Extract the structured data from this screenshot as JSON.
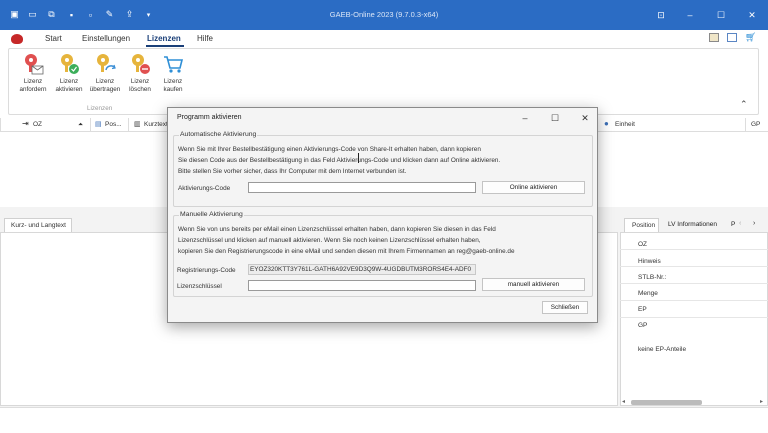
{
  "window": {
    "title": "GAEB-Online 2023 (9.7.0.3-x64)",
    "controls": {
      "settings": "⊡",
      "minimize": "–",
      "maximize": "☐",
      "close": "✕"
    },
    "accent": "#2b6cc4"
  },
  "quick_access": [
    "app-icon",
    "open-folder-icon",
    "copy-icon",
    "save-icon",
    "save-as-icon",
    "edit-icon",
    "export-icon",
    "customize-icon"
  ],
  "menu": {
    "items": [
      "Start",
      "Einstellungen",
      "Lizenzen",
      "Hilfe"
    ],
    "active": "Lizenzen"
  },
  "ribbon": {
    "buttons": [
      {
        "line1": "Lizenz",
        "line2": "anfordern",
        "icon": "key-mail-icon"
      },
      {
        "line1": "Lizenz",
        "line2": "aktivieren",
        "icon": "key-check-icon"
      },
      {
        "line1": "Lizenz",
        "line2": "übertragen",
        "icon": "key-transfer-icon"
      },
      {
        "line1": "Lizenz",
        "line2": "löschen",
        "icon": "key-delete-icon"
      },
      {
        "line1": "Lizenz",
        "line2": "kaufen",
        "icon": "cart-icon"
      }
    ],
    "group_label": "Lizenzen",
    "collapse": "⌃"
  },
  "grid": {
    "columns": [
      "OZ",
      "Pos...",
      "Kurztext",
      "Einheit",
      "GP"
    ]
  },
  "bottom_left": {
    "tab": "Kurz- und Langtext"
  },
  "right_panel": {
    "tabs": [
      "Position",
      "LV Informationen",
      "P"
    ],
    "properties": [
      "OZ",
      "Hinweis",
      "STLB-Nr.:",
      "Menge",
      "EP",
      "GP"
    ],
    "note": "keine EP-Anteile"
  },
  "dialog": {
    "title": "Programm aktivieren",
    "auto": {
      "title": "Automatische Aktivierung",
      "lines": [
        "Wenn Sie mit Ihrer Bestellbestätigung einen Aktivierungs-Code von Share-It erhalten haben, dann kopieren",
        "Sie diesen Code aus der Bestellbestätigung in das Feld Aktivierungs-Code und klicken dann auf Online aktivieren.",
        "Bitte stellen Sie vorher sicher, dass Ihr Computer mit dem Internet verbunden ist."
      ],
      "code_label": "Aktivierungs-Code",
      "code_value": "",
      "button": "Online aktivieren"
    },
    "manual": {
      "title": "Manuelle Aktivierung",
      "lines": [
        "Wenn Sie von uns bereits per eMail einen Lizenzschlüssel erhalten haben, dann kopieren Sie diesen in das Feld",
        "Lizenzschlüssel und klicken auf manuell aktivieren. Wenn Sie noch keinen Lizenzschlüssel erhalten haben,",
        "kopieren Sie den Registrierungscode in eine eMail und senden diesen mit Ihrem Firmennamen an reg@gaeb-online.de"
      ],
      "reg_label": "Registrierungs-Code",
      "reg_value": "EYOZ320KTT3Y761L-GATH6A92VE9D3Q9W-4UGDBUTM3RORS4E4-ADF0",
      "key_label": "Lizenzschlüssel",
      "key_value": "",
      "button": "manuell aktivieren"
    },
    "close_button": "Schließen"
  }
}
